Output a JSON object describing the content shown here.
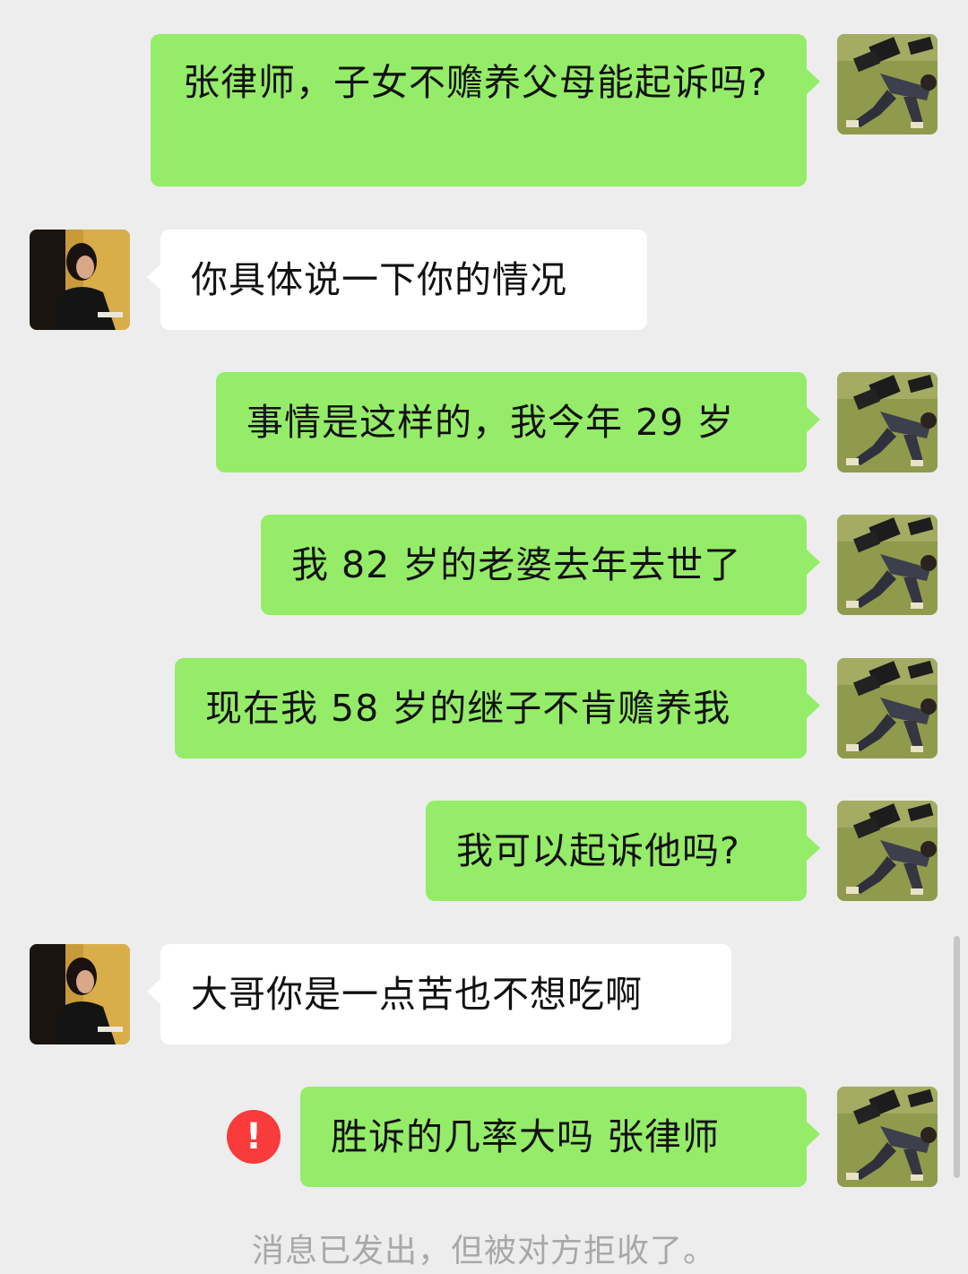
{
  "conversation": {
    "messages": [
      {
        "id": "m1",
        "side": "sent",
        "text": "张律师，子女不赡养父母能起诉吗?"
      },
      {
        "id": "m2",
        "side": "received",
        "text": "你具体说一下你的情况"
      },
      {
        "id": "m3",
        "side": "sent",
        "text": "事情是这样的，我今年 29 岁"
      },
      {
        "id": "m4",
        "side": "sent",
        "text": "我 82 岁的老婆去年去世了"
      },
      {
        "id": "m5",
        "side": "sent",
        "text": "现在我 58 岁的继子不肯赡养我"
      },
      {
        "id": "m6",
        "side": "sent",
        "text": "我可以起诉他吗?"
      },
      {
        "id": "m7",
        "side": "received",
        "text": "大哥你是一点苦也不想吃啊"
      },
      {
        "id": "m8",
        "side": "sent",
        "text": "胜诉的几率大吗  张律师",
        "status": "failed"
      }
    ],
    "error_glyph": "!",
    "status_note": "消息已发出，但被对方拒收了。"
  },
  "colors": {
    "background": "#ededed",
    "sent_bubble": "#95ec69",
    "received_bubble": "#ffffff",
    "error_badge": "#fa3b3b",
    "status_text": "#a8a8a8"
  },
  "icons": {
    "sender_avatar": "person-lying-on-floor-photo",
    "receiver_avatar": "woman-with-short-hair-photo",
    "error": "exclamation-circle-icon"
  }
}
